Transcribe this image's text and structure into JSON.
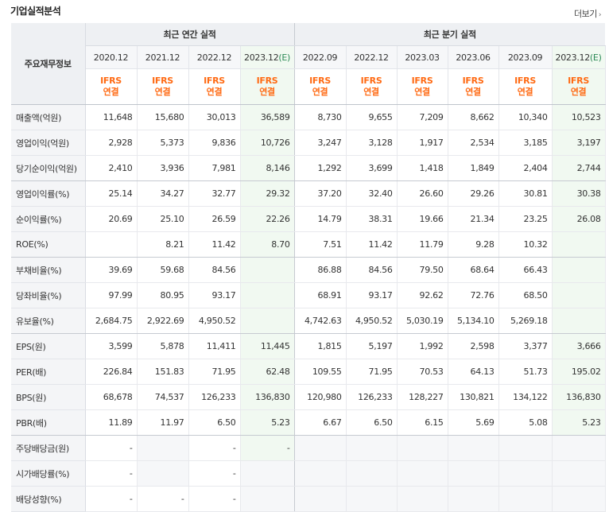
{
  "header": {
    "title": "기업실적분석",
    "more_label": "더보기"
  },
  "table": {
    "corner_label": "주요재무정보",
    "annual_caption": "최근 연간 실적",
    "quarter_caption": "최근 분기 실적",
    "annual_periods": [
      "2020.12",
      "2021.12",
      "2022.12",
      "2023.12(E)"
    ],
    "quarter_periods": [
      "2022.09",
      "2022.12",
      "2023.03",
      "2023.06",
      "2023.09",
      "2023.12(E)"
    ],
    "ifrs_top": "IFRS",
    "ifrs_bottom": "연결",
    "colors": {
      "estimate_bg": "#f1f9f1",
      "estimate_text": "#2e8b57",
      "ifrs": "#ff6a13"
    },
    "rows": [
      {
        "label": "매출액(억원)",
        "values": [
          "11,648",
          "15,680",
          "30,013",
          "36,589",
          "8,730",
          "9,655",
          "7,209",
          "8,662",
          "10,340",
          "10,523"
        ]
      },
      {
        "label": "영업이익(억원)",
        "values": [
          "2,928",
          "5,373",
          "9,836",
          "10,726",
          "3,247",
          "3,128",
          "1,917",
          "2,534",
          "3,185",
          "3,197"
        ]
      },
      {
        "label": "당기순이익(억원)",
        "values": [
          "2,410",
          "3,936",
          "7,981",
          "8,146",
          "1,292",
          "3,699",
          "1,418",
          "1,849",
          "2,404",
          "2,744"
        ]
      },
      {
        "label": "영업이익률(%)",
        "values": [
          "25.14",
          "34.27",
          "32.77",
          "29.32",
          "37.20",
          "32.40",
          "26.60",
          "29.26",
          "30.81",
          "30.38"
        ]
      },
      {
        "label": "순이익률(%)",
        "values": [
          "20.69",
          "25.10",
          "26.59",
          "22.26",
          "14.79",
          "38.31",
          "19.66",
          "21.34",
          "23.25",
          "26.08"
        ]
      },
      {
        "label": "ROE(%)",
        "values": [
          "",
          "8.21",
          "11.42",
          "8.70",
          "7.51",
          "11.42",
          "11.79",
          "9.28",
          "10.32",
          ""
        ]
      },
      {
        "label": "부채비율(%)",
        "values": [
          "39.69",
          "59.68",
          "84.56",
          "",
          "86.88",
          "84.56",
          "79.50",
          "68.64",
          "66.43",
          ""
        ]
      },
      {
        "label": "당좌비율(%)",
        "values": [
          "97.99",
          "80.95",
          "93.17",
          "",
          "68.91",
          "93.17",
          "92.62",
          "72.76",
          "68.50",
          ""
        ]
      },
      {
        "label": "유보율(%)",
        "values": [
          "2,684.75",
          "2,922.69",
          "4,950.52",
          "",
          "4,742.63",
          "4,950.52",
          "5,030.19",
          "5,134.10",
          "5,269.18",
          ""
        ]
      },
      {
        "label": "EPS(원)",
        "values": [
          "3,599",
          "5,878",
          "11,411",
          "11,445",
          "1,815",
          "5,197",
          "1,992",
          "2,598",
          "3,377",
          "3,666"
        ]
      },
      {
        "label": "PER(배)",
        "values": [
          "226.84",
          "151.83",
          "71.95",
          "62.48",
          "109.55",
          "71.95",
          "70.53",
          "64.13",
          "51.73",
          "195.02"
        ]
      },
      {
        "label": "BPS(원)",
        "values": [
          "68,678",
          "74,537",
          "126,233",
          "136,830",
          "120,980",
          "126,233",
          "128,227",
          "130,821",
          "134,122",
          "136,830"
        ]
      },
      {
        "label": "PBR(배)",
        "values": [
          "11.89",
          "11.97",
          "6.50",
          "5.23",
          "6.67",
          "6.50",
          "6.15",
          "5.69",
          "5.08",
          "5.23"
        ]
      },
      {
        "label": "주당배당금(원)",
        "values": [
          "-",
          "",
          "-",
          "-",
          "",
          "",
          "",
          "",
          "",
          ""
        ]
      },
      {
        "label": "시가배당률(%)",
        "values": [
          "-",
          "",
          "-",
          "",
          "",
          "",
          "",
          "",
          "",
          ""
        ]
      },
      {
        "label": "배당성향(%)",
        "values": [
          "-",
          "-",
          "-",
          "",
          "",
          "",
          "",
          "",
          "",
          ""
        ]
      }
    ]
  }
}
